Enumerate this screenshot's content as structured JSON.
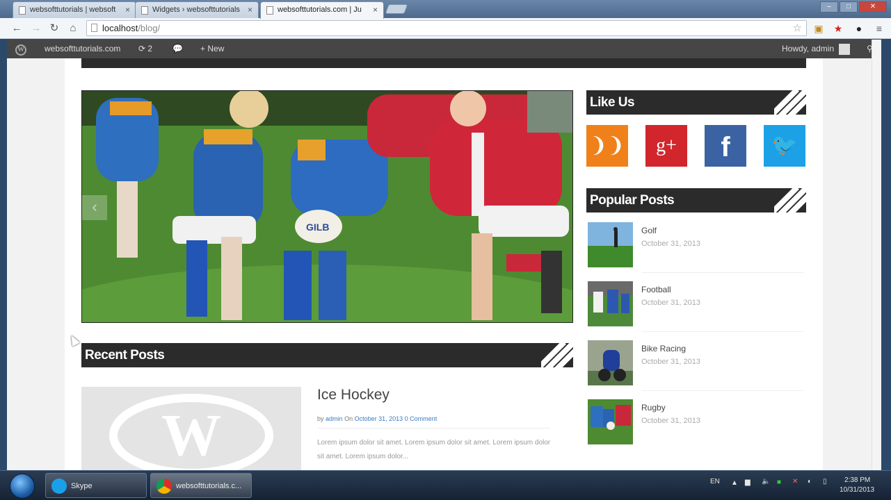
{
  "browser": {
    "tabs": [
      {
        "title": "websofttutorials | websoft"
      },
      {
        "title": "Widgets › websofttutorials"
      },
      {
        "title": "websofttutorials.com | Ju"
      }
    ],
    "address": {
      "host": "localhost",
      "path": "/blog/"
    }
  },
  "adminbar": {
    "site_name": "websofttutorials.com",
    "updates_count": "2",
    "new_label": "New",
    "howdy": "Howdy, admin"
  },
  "sidebar": {
    "like_us": "Like Us",
    "social": [
      {
        "name": "rss",
        "glyph": "❩❩",
        "color": "#f0811a"
      },
      {
        "name": "google-plus",
        "glyph": "g+",
        "color": "#d0262c"
      },
      {
        "name": "facebook",
        "glyph": "f",
        "color": "#3b63a4"
      },
      {
        "name": "twitter",
        "glyph": "🐦",
        "color": "#1da1e6"
      }
    ],
    "popular_posts_title": "Popular Posts",
    "popular_posts": [
      {
        "title": "Golf",
        "date": "October 31, 2013"
      },
      {
        "title": "Football",
        "date": "October 31, 2013"
      },
      {
        "title": "Bike Racing",
        "date": "October 31, 2013"
      },
      {
        "title": "Rugby",
        "date": "October 31, 2013"
      }
    ]
  },
  "main": {
    "slider_prev": "‹",
    "recent_posts_title": "Recent Posts",
    "post": {
      "title": "Ice Hockey",
      "meta_by": "by",
      "author": "admin",
      "meta_on": "On",
      "date": "October 31, 2013",
      "comments": "0 Comment",
      "excerpt": "Lorem ipsum dolor sit amet. Lorem ipsum dolor sit amet. Lorem ipsum dolor sit amet. Lorem ipsum dolor..."
    }
  },
  "taskbar": {
    "tasks": [
      {
        "label": "Skype"
      },
      {
        "label": "websofttutorials.c..."
      }
    ],
    "language": "EN",
    "time": "2:38 PM",
    "date": "10/31/2013"
  }
}
